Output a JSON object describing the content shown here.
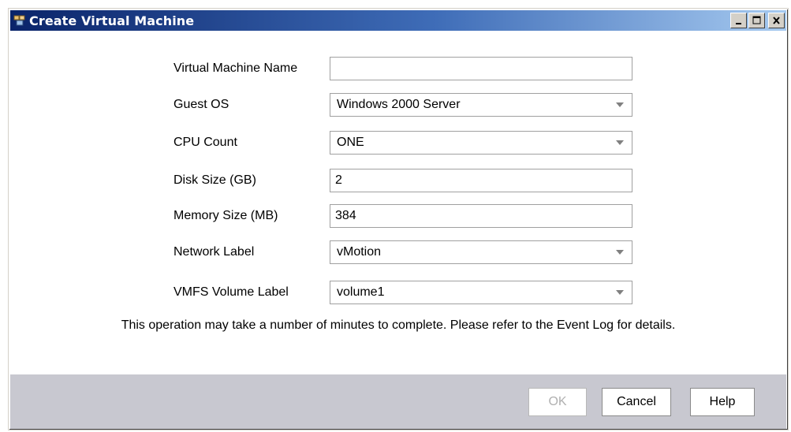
{
  "window": {
    "title": "Create Virtual Machine"
  },
  "form": {
    "fields": [
      {
        "label": "Virtual Machine Name",
        "value": "",
        "type": "text"
      },
      {
        "label": "Guest OS",
        "value": "Windows 2000 Server",
        "type": "select"
      },
      {
        "label": "CPU Count",
        "value": "ONE",
        "type": "select"
      },
      {
        "label": "Disk Size (GB)",
        "value": "2",
        "type": "text"
      },
      {
        "label": "Memory Size (MB)",
        "value": "384",
        "type": "text"
      },
      {
        "label": "Network Label",
        "value": "vMotion",
        "type": "select"
      },
      {
        "label": "VMFS Volume Label",
        "value": "volume1",
        "type": "select"
      }
    ],
    "note": "This operation may take a number of minutes to complete. Please refer to the Event Log for details."
  },
  "buttons": {
    "ok": "OK",
    "cancel": "Cancel",
    "help": "Help"
  },
  "icons": {
    "window_icon": "vm-icon",
    "minimize": "minimize-icon",
    "maximize": "maximize-icon",
    "close": "close-icon",
    "dropdown": "chevron-down-icon"
  }
}
